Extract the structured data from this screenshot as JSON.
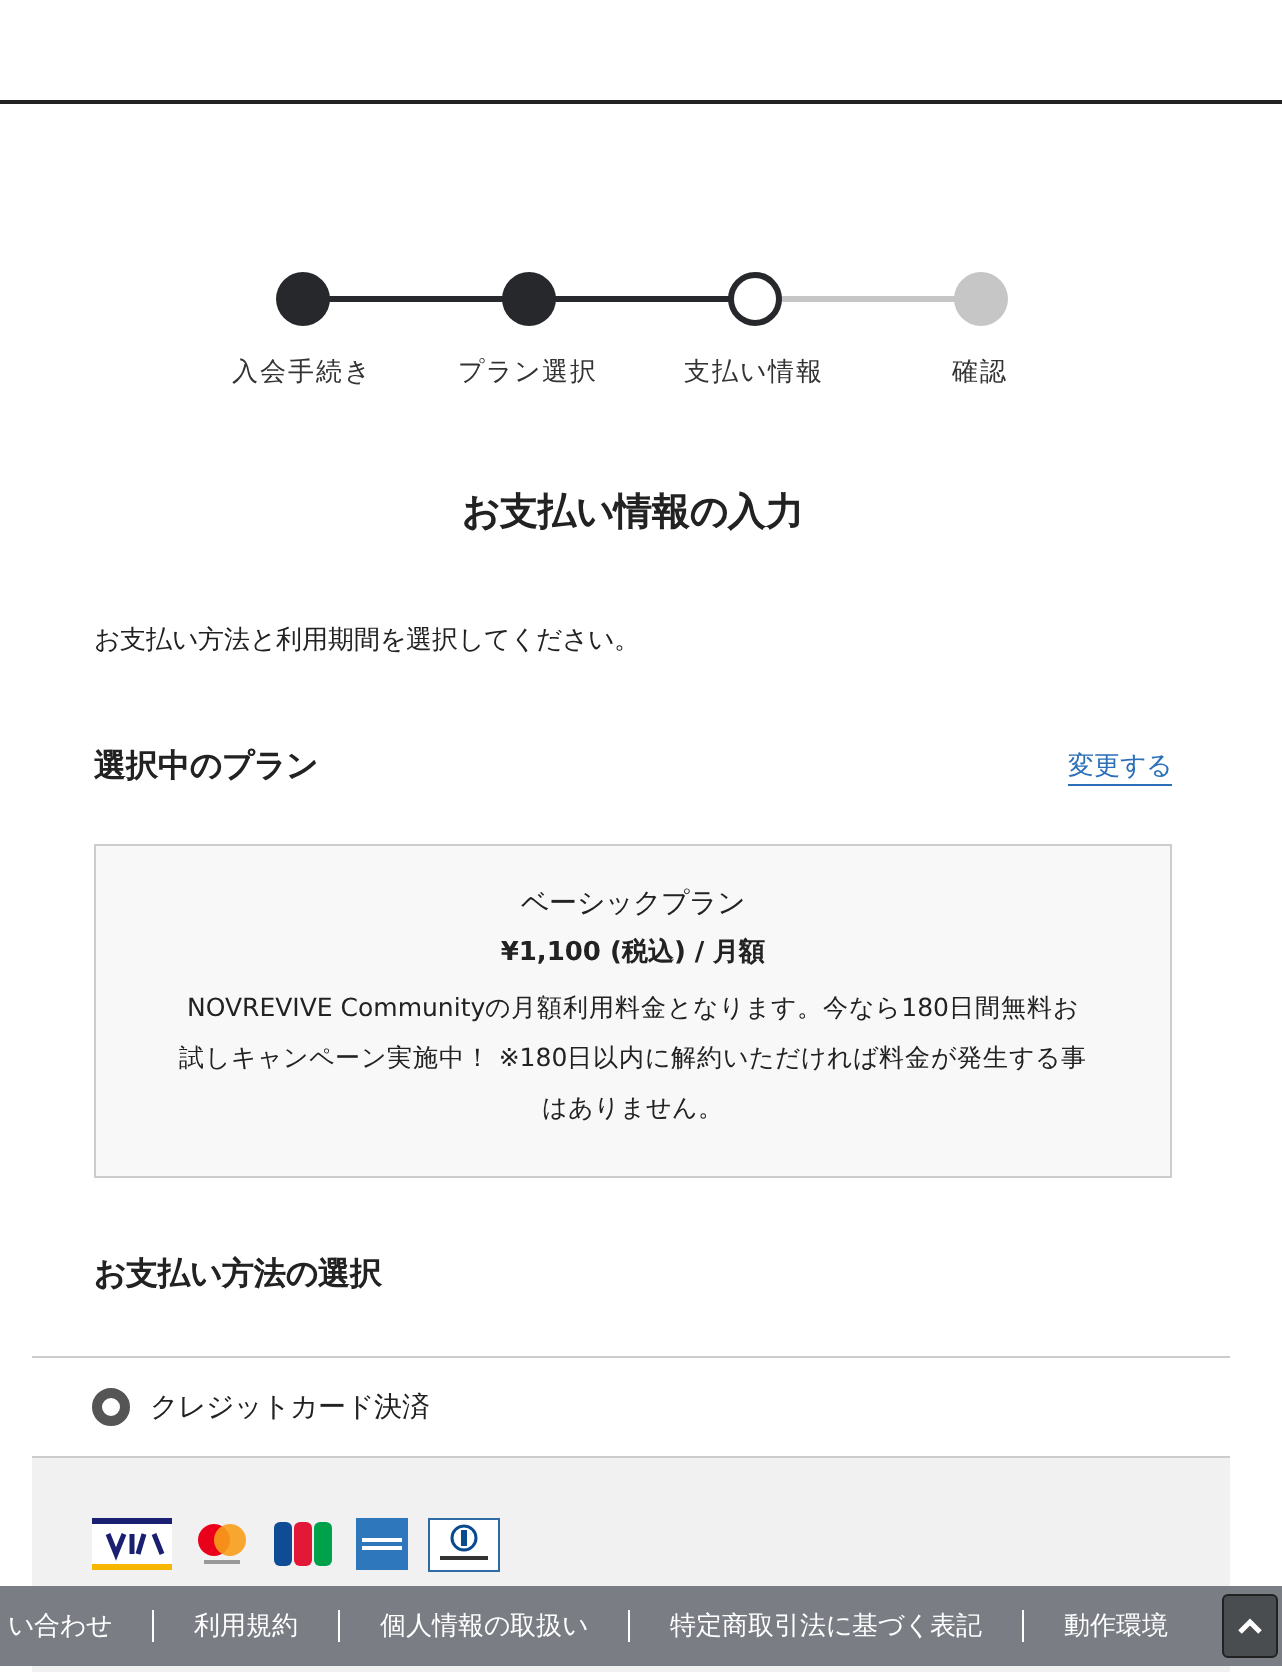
{
  "steps": [
    {
      "label": "入会手続き",
      "done": true,
      "current": false
    },
    {
      "label": "プラン選択",
      "done": true,
      "current": false
    },
    {
      "label": "支払い情報",
      "done": false,
      "current": true
    },
    {
      "label": "確認",
      "done": false,
      "current": false
    }
  ],
  "title": "お支払い情報の入力",
  "intro": "お支払い方法と利用期間を選択してください。",
  "plan_section": {
    "heading": "選択中のプラン",
    "change_link": "変更する"
  },
  "plan": {
    "name": "ベーシックプラン",
    "price": "¥1,100 (税込) / 月額",
    "description": "NOVREVIVE Communityの月額利用料金となります。今なら180日間無料お試しキャンペーン実施中！ ※180日以内に解約いただければ料金が発生する事はありません。"
  },
  "payment_section": {
    "heading": "お支払い方法の選択"
  },
  "payment_methods": [
    {
      "label": "クレジットカード決済",
      "selected": true
    }
  ],
  "footer_links": [
    "い合わせ",
    "利用規約",
    "個人情報の取扱い",
    "特定商取引法に基づく表記",
    "動作環境"
  ]
}
